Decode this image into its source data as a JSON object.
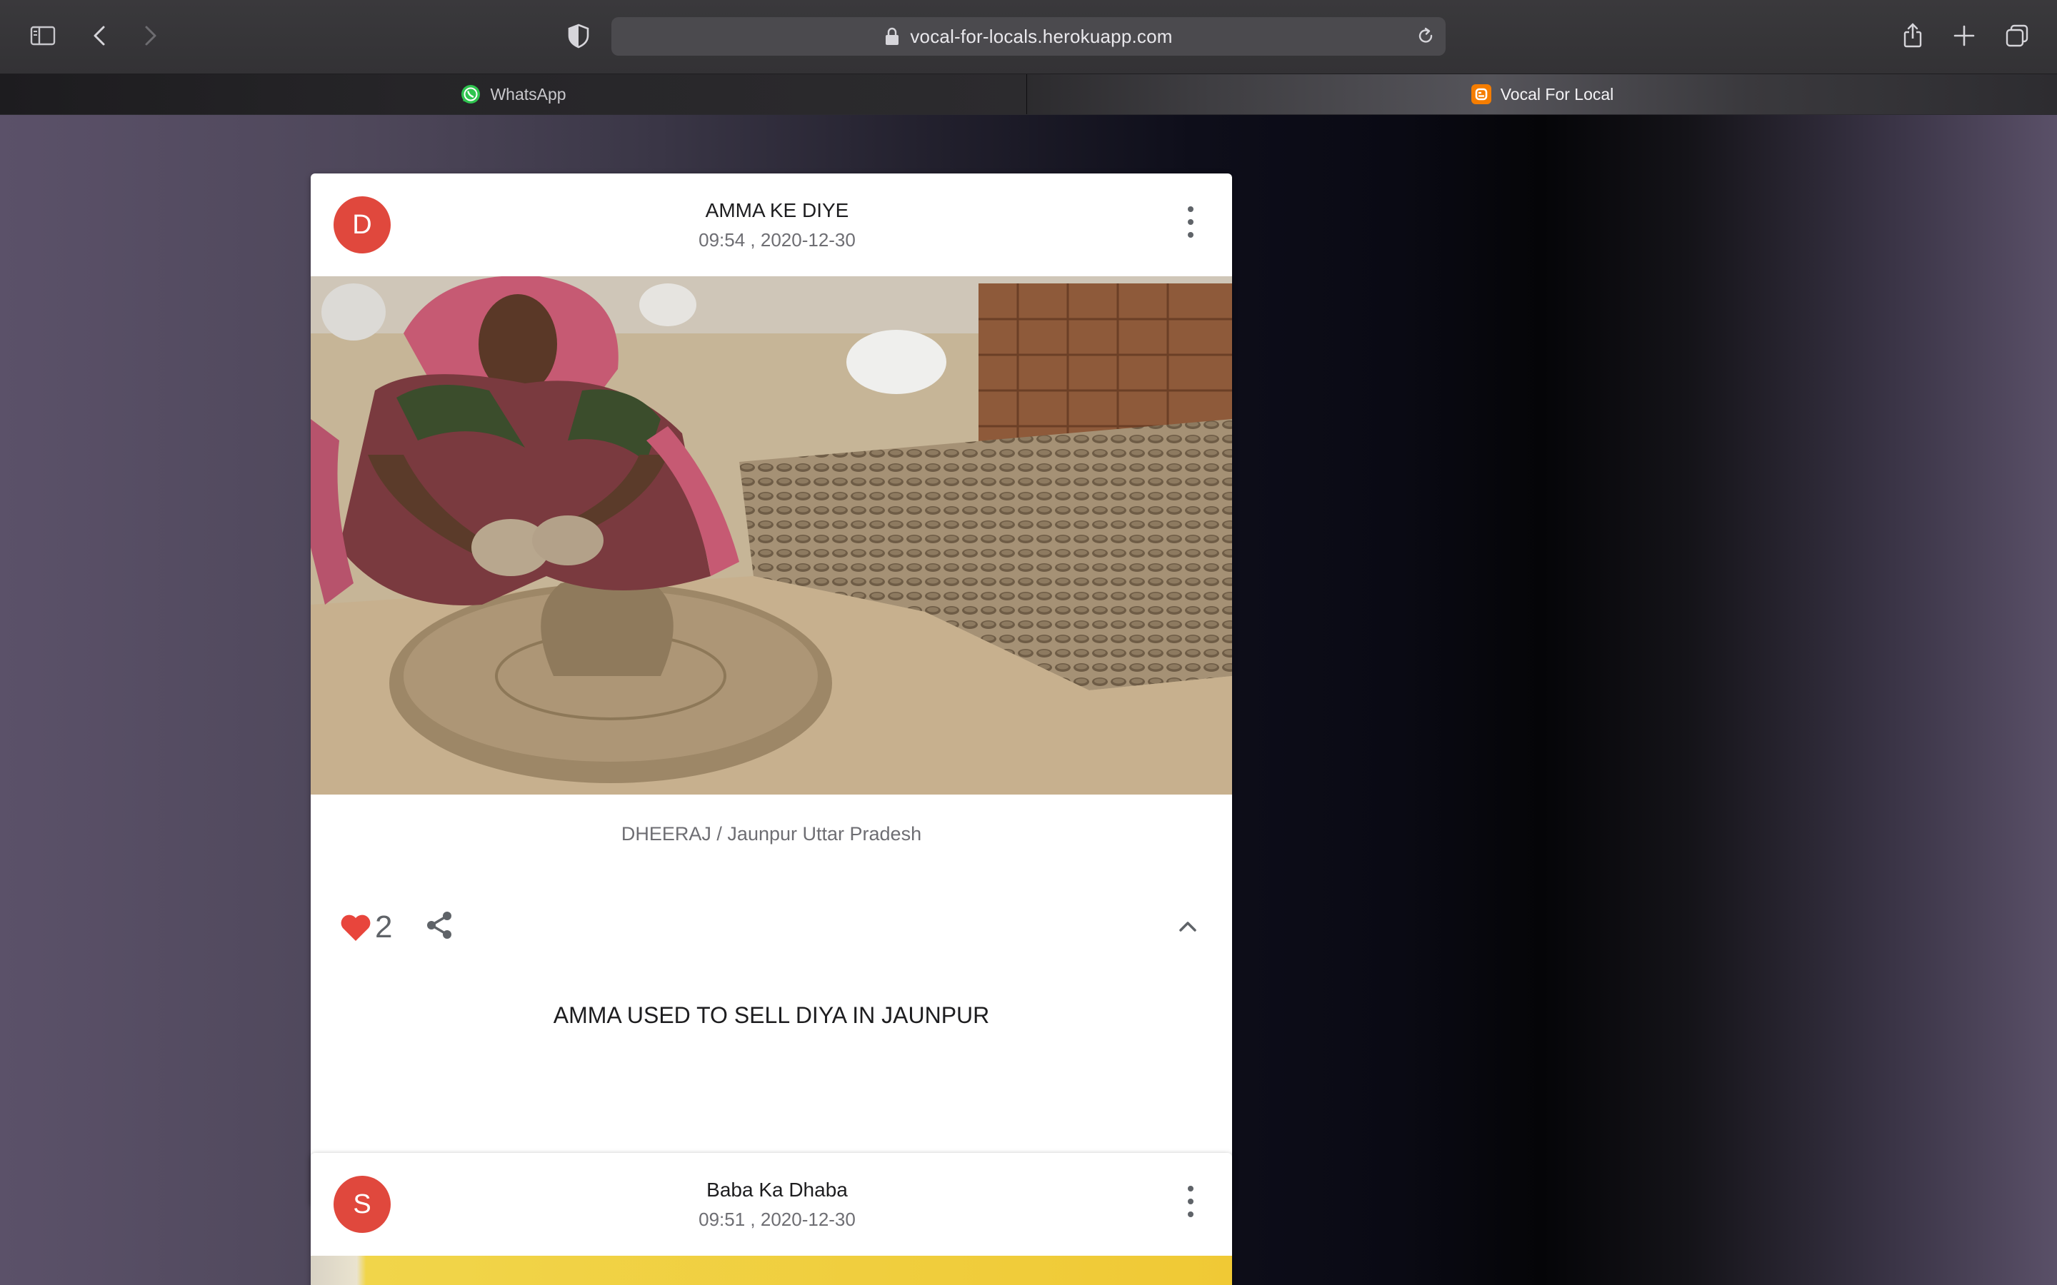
{
  "browser": {
    "url": "vocal-for-locals.herokuapp.com",
    "tabs": [
      {
        "label": "WhatsApp",
        "favicon": "whatsapp-icon",
        "active": false
      },
      {
        "label": "Vocal For Local",
        "favicon": "blogger-icon",
        "active": true
      }
    ],
    "toolbar_icons": [
      "sidebar-icon",
      "back-icon",
      "forward-icon",
      "shield-icon",
      "lock-icon",
      "reload-icon",
      "share-icon",
      "plus-icon",
      "tabs-overview-icon"
    ]
  },
  "posts": [
    {
      "avatar_letter": "D",
      "title": "AMMA KE DIYE",
      "timestamp": "09:54 , 2020-12-30",
      "caption": "DHEERAJ / Jaunpur Uttar Pradesh",
      "likes": "2",
      "description": "AMMA USED TO SELL DIYA IN JAUNPUR"
    },
    {
      "avatar_letter": "S",
      "title": "Baba Ka Dhaba",
      "timestamp": "09:51 , 2020-12-30"
    }
  ],
  "colors": {
    "avatar": "#e0483d",
    "heart": "#e8453c",
    "card": "#ffffff"
  }
}
